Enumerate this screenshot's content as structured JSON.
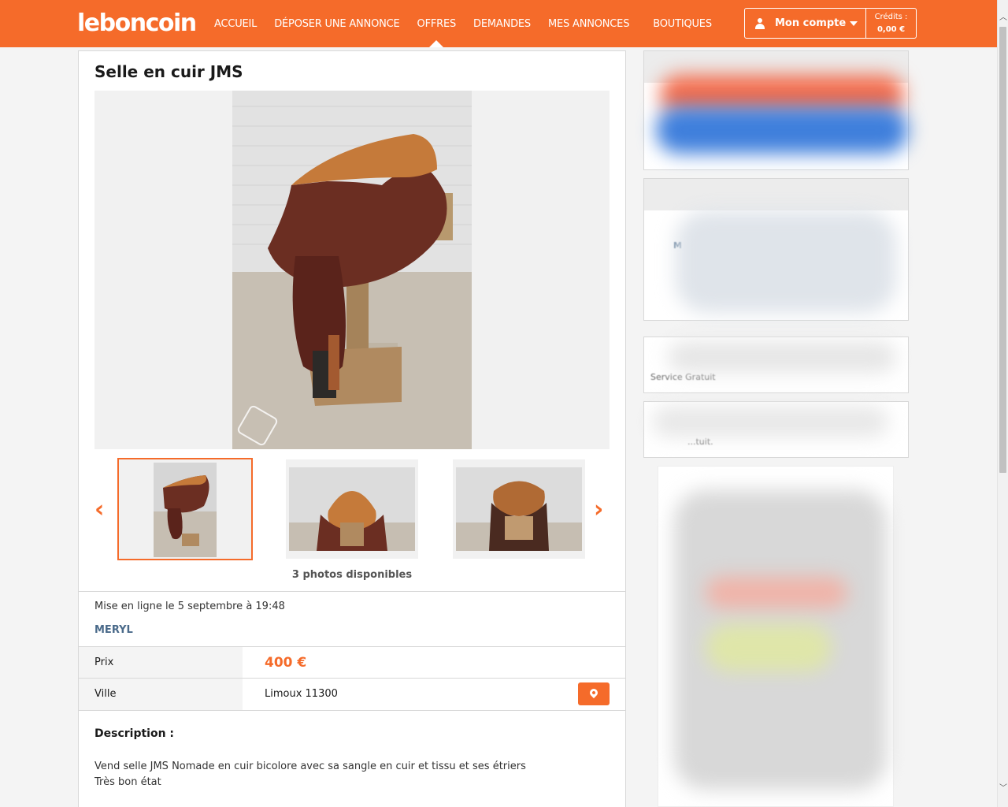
{
  "header": {
    "logo": "leboncoin",
    "nav": [
      "ACCUEIL",
      "DÉPOSER UNE ANNONCE",
      "OFFRES",
      "DEMANDES",
      "MES ANNONCES",
      "BOUTIQUES"
    ],
    "active_nav": "OFFRES",
    "account_label": "Mon compte",
    "credits_label": "Crédits :",
    "credits_value": "0,00 €"
  },
  "ad": {
    "title": "Selle en cuir JMS",
    "photos_count": "3 photos disponibles",
    "posted": "Mise en ligne le 5 septembre à 19:48",
    "seller": "MERYL",
    "price_label": "Prix",
    "price": "400 €",
    "city_label": "Ville",
    "city": "Limoux 11300",
    "description_title": "Description :",
    "description": "Vend selle JMS Nomade en cuir bicolore avec sa sangle en cuir et tissu et ses étriers\nTrès bon état"
  },
  "sidebar": {
    "text_1": "M",
    "text_2": "Service Gratuit",
    "text_3": "...tuit."
  },
  "colors": {
    "brand": "#f56b2a",
    "seller_link": "#4a6a8a"
  }
}
